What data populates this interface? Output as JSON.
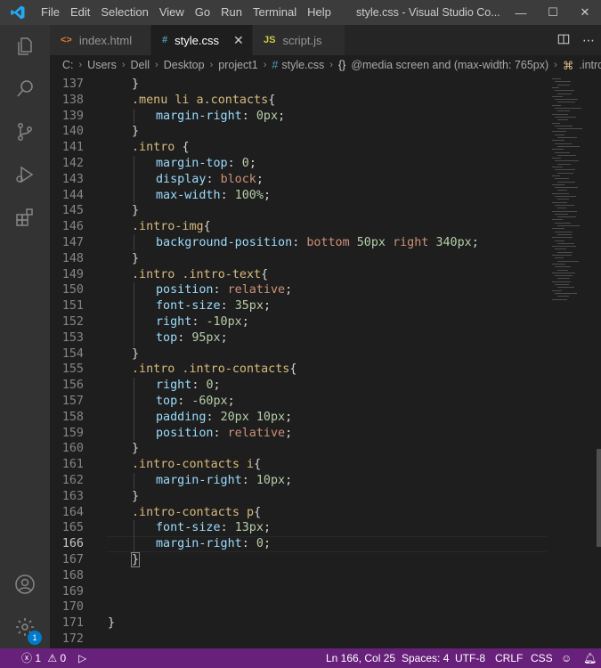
{
  "titlebar": {
    "menu": [
      "File",
      "Edit",
      "Selection",
      "View",
      "Go",
      "Run",
      "Terminal",
      "Help"
    ],
    "window_title": "style.css - Visual Studio Co...",
    "minimize": "—",
    "maximize": "☐",
    "close": "✕"
  },
  "tabs": [
    {
      "label": "index.html",
      "icon": "<>",
      "active": false
    },
    {
      "label": "style.css",
      "icon": "#",
      "active": true,
      "close": "✕"
    },
    {
      "label": "script.js",
      "icon": "JS",
      "active": false
    }
  ],
  "breadcrumb": {
    "items": [
      "C:",
      "Users",
      "Dell",
      "Desktop",
      "project1",
      "style.css",
      "@media screen and (max-width: 765px)",
      ".intro-..."
    ]
  },
  "editor": {
    "current_line": 166,
    "lines": [
      {
        "n": "137",
        "indent": 1,
        "tokens": [
          [
            "punc",
            "}"
          ]
        ]
      },
      {
        "n": "138",
        "indent": 1,
        "tokens": [
          [
            "sel",
            ".menu li a.contacts"
          ],
          [
            "punc",
            "{"
          ]
        ]
      },
      {
        "n": "139",
        "indent": 2,
        "tokens": [
          [
            "prop",
            "margin-right"
          ],
          [
            "punc",
            ": "
          ],
          [
            "num",
            "0px"
          ],
          [
            "punc",
            ";"
          ]
        ]
      },
      {
        "n": "140",
        "indent": 1,
        "tokens": [
          [
            "punc",
            "}"
          ]
        ]
      },
      {
        "n": "141",
        "indent": 1,
        "tokens": [
          [
            "sel",
            ".intro "
          ],
          [
            "punc",
            "{"
          ]
        ]
      },
      {
        "n": "142",
        "indent": 2,
        "tokens": [
          [
            "prop",
            "margin-top"
          ],
          [
            "punc",
            ": "
          ],
          [
            "num",
            "0"
          ],
          [
            "punc",
            ";"
          ]
        ]
      },
      {
        "n": "143",
        "indent": 2,
        "tokens": [
          [
            "prop",
            "display"
          ],
          [
            "punc",
            ": "
          ],
          [
            "val",
            "block"
          ],
          [
            "punc",
            ";"
          ]
        ]
      },
      {
        "n": "144",
        "indent": 2,
        "tokens": [
          [
            "prop",
            "max-width"
          ],
          [
            "punc",
            ": "
          ],
          [
            "num",
            "100%"
          ],
          [
            "punc",
            ";"
          ]
        ]
      },
      {
        "n": "145",
        "indent": 1,
        "tokens": [
          [
            "punc",
            "}"
          ]
        ]
      },
      {
        "n": "146",
        "indent": 1,
        "tokens": [
          [
            "sel",
            ".intro-img"
          ],
          [
            "punc",
            "{"
          ]
        ]
      },
      {
        "n": "147",
        "indent": 2,
        "tokens": [
          [
            "prop",
            "background-position"
          ],
          [
            "punc",
            ": "
          ],
          [
            "val",
            "bottom "
          ],
          [
            "num",
            "50px "
          ],
          [
            "val",
            "right "
          ],
          [
            "num",
            "340px"
          ],
          [
            "punc",
            ";"
          ]
        ]
      },
      {
        "n": "148",
        "indent": 1,
        "tokens": [
          [
            "punc",
            "}"
          ]
        ]
      },
      {
        "n": "149",
        "indent": 1,
        "tokens": [
          [
            "sel",
            ".intro .intro-text"
          ],
          [
            "punc",
            "{"
          ]
        ]
      },
      {
        "n": "150",
        "indent": 2,
        "tokens": [
          [
            "prop",
            "position"
          ],
          [
            "punc",
            ": "
          ],
          [
            "val",
            "relative"
          ],
          [
            "punc",
            ";"
          ]
        ]
      },
      {
        "n": "151",
        "indent": 2,
        "tokens": [
          [
            "prop",
            "font-size"
          ],
          [
            "punc",
            ": "
          ],
          [
            "num",
            "35px"
          ],
          [
            "punc",
            ";"
          ]
        ]
      },
      {
        "n": "152",
        "indent": 2,
        "tokens": [
          [
            "prop",
            "right"
          ],
          [
            "punc",
            ": "
          ],
          [
            "num",
            "-10px"
          ],
          [
            "punc",
            ";"
          ]
        ]
      },
      {
        "n": "153",
        "indent": 2,
        "tokens": [
          [
            "prop",
            "top"
          ],
          [
            "punc",
            ": "
          ],
          [
            "num",
            "95px"
          ],
          [
            "punc",
            ";"
          ]
        ]
      },
      {
        "n": "154",
        "indent": 1,
        "tokens": [
          [
            "punc",
            "}"
          ]
        ]
      },
      {
        "n": "155",
        "indent": 1,
        "tokens": [
          [
            "sel",
            ".intro .intro-contacts"
          ],
          [
            "punc",
            "{"
          ]
        ]
      },
      {
        "n": "156",
        "indent": 2,
        "tokens": [
          [
            "prop",
            "right"
          ],
          [
            "punc",
            ": "
          ],
          [
            "num",
            "0"
          ],
          [
            "punc",
            ";"
          ]
        ]
      },
      {
        "n": "157",
        "indent": 2,
        "tokens": [
          [
            "prop",
            "top"
          ],
          [
            "punc",
            ": "
          ],
          [
            "num",
            "-60px"
          ],
          [
            "punc",
            ";"
          ]
        ]
      },
      {
        "n": "158",
        "indent": 2,
        "tokens": [
          [
            "prop",
            "padding"
          ],
          [
            "punc",
            ": "
          ],
          [
            "num",
            "20px 10px"
          ],
          [
            "punc",
            ";"
          ]
        ]
      },
      {
        "n": "159",
        "indent": 2,
        "tokens": [
          [
            "prop",
            "position"
          ],
          [
            "punc",
            ": "
          ],
          [
            "val",
            "relative"
          ],
          [
            "punc",
            ";"
          ]
        ]
      },
      {
        "n": "160",
        "indent": 1,
        "tokens": [
          [
            "punc",
            "}"
          ]
        ]
      },
      {
        "n": "161",
        "indent": 1,
        "tokens": [
          [
            "sel",
            ".intro-contacts i"
          ],
          [
            "punc",
            "{"
          ]
        ]
      },
      {
        "n": "162",
        "indent": 2,
        "tokens": [
          [
            "prop",
            "margin-right"
          ],
          [
            "punc",
            ": "
          ],
          [
            "num",
            "10px"
          ],
          [
            "punc",
            ";"
          ]
        ]
      },
      {
        "n": "163",
        "indent": 1,
        "tokens": [
          [
            "punc",
            "}"
          ]
        ]
      },
      {
        "n": "164",
        "indent": 1,
        "tokens": [
          [
            "sel",
            ".intro-contacts p"
          ],
          [
            "punc",
            "{"
          ]
        ]
      },
      {
        "n": "165",
        "indent": 2,
        "tokens": [
          [
            "prop",
            "font-size"
          ],
          [
            "punc",
            ": "
          ],
          [
            "num",
            "13px"
          ],
          [
            "punc",
            ";"
          ]
        ]
      },
      {
        "n": "166",
        "indent": 2,
        "tokens": [
          [
            "prop",
            "margin-right"
          ],
          [
            "punc",
            ": "
          ],
          [
            "num",
            "0"
          ],
          [
            "punc",
            ";"
          ]
        ]
      },
      {
        "n": "167",
        "indent": 1,
        "tokens": [
          [
            "punc",
            "}"
          ]
        ]
      },
      {
        "n": "168",
        "indent": 0,
        "tokens": []
      },
      {
        "n": "169",
        "indent": 0,
        "tokens": []
      },
      {
        "n": "170",
        "indent": 0,
        "tokens": []
      },
      {
        "n": "171",
        "indent": 0,
        "tokens": [
          [
            "punc",
            "}"
          ]
        ]
      },
      {
        "n": "172",
        "indent": 0,
        "tokens": []
      }
    ]
  },
  "statusbar": {
    "errors": "1",
    "warnings": "0",
    "position": "Ln 166, Col 25",
    "spaces": "Spaces: 4",
    "encoding": "UTF-8",
    "eol": "CRLF",
    "language": "CSS"
  },
  "activity": {
    "icons": [
      "files-icon",
      "search-icon",
      "source-control-icon",
      "run-debug-icon",
      "extensions-icon",
      "account-icon",
      "settings-gear-icon"
    ],
    "settings_badge": "1"
  },
  "colors": {
    "statusbar": "#68217a",
    "selector": "#d7ba7d",
    "property": "#9cdcfe",
    "value": "#ce9178",
    "number": "#b5cea8"
  }
}
